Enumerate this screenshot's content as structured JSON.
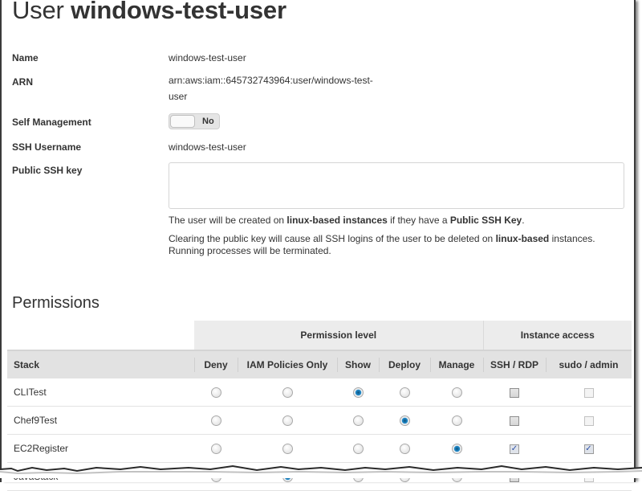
{
  "header": {
    "title_prefix": "User",
    "title_name": "windows-test-user"
  },
  "fields": {
    "name": {
      "label": "Name",
      "value": "windows-test-user"
    },
    "arn": {
      "label": "ARN",
      "value": "arn:aws:iam::645732743964:user/windows-test-user"
    },
    "self_management": {
      "label": "Self Management",
      "toggle_label": "No",
      "enabled": false
    },
    "ssh_username": {
      "label": "SSH Username",
      "value": "windows-test-user"
    },
    "public_ssh_key": {
      "label": "Public SSH key",
      "value": ""
    }
  },
  "notes": {
    "note1": {
      "t1": "The user will be created on ",
      "b1": "linux-based instances",
      "t2": " if they have a ",
      "b2": "Public SSH Key",
      "t3": "."
    },
    "note2": {
      "t1": "Clearing the public key will cause all SSH logins of the user to be deleted on ",
      "b1": "linux-based",
      "t2": " instances. Running processes will be terminated."
    }
  },
  "permissions": {
    "title": "Permissions",
    "group_headers": {
      "permission_level": "Permission level",
      "instance_access": "Instance access"
    },
    "columns": [
      "Stack",
      "Deny",
      "IAM Policies Only",
      "Show",
      "Deploy",
      "Manage",
      "SSH / RDP",
      "sudo / admin"
    ],
    "rows": [
      {
        "stack": "CLITest",
        "level": "Show",
        "ssh_rdp": false,
        "sudo_admin": false,
        "sudo_disabled": true
      },
      {
        "stack": "Chef9Test",
        "level": "Deploy",
        "ssh_rdp": false,
        "sudo_admin": false,
        "sudo_disabled": true
      },
      {
        "stack": "EC2Register",
        "level": "Manage",
        "ssh_rdp": true,
        "sudo_admin": true,
        "sudo_disabled": false
      },
      {
        "stack": "JavaStack",
        "level": "IAM Policies Only",
        "ssh_rdp": false,
        "sudo_admin": false,
        "sudo_disabled": true
      }
    ],
    "check_glyph": "✓"
  }
}
